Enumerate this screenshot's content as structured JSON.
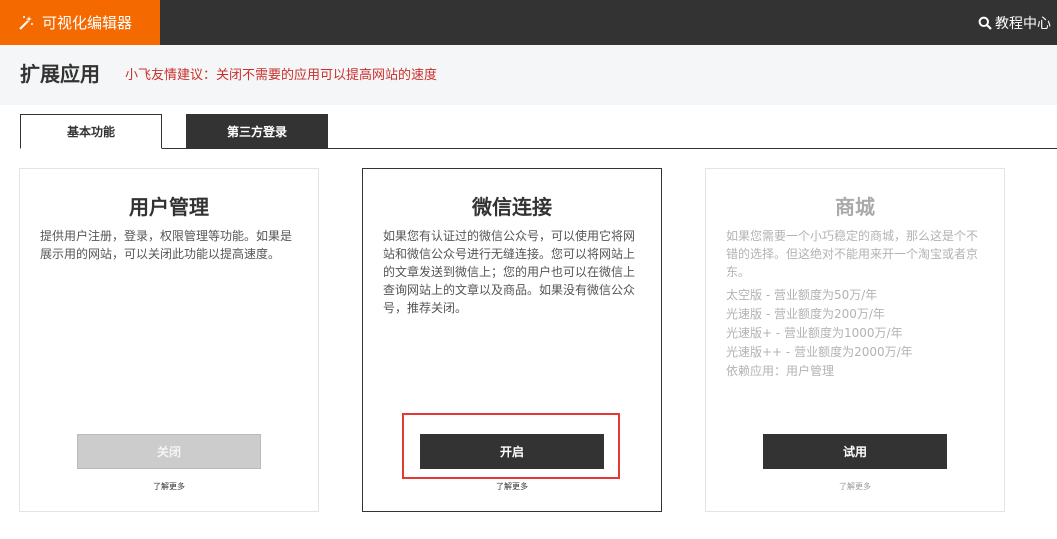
{
  "header": {
    "brand": "可视化编辑器",
    "tutorial": "教程中心"
  },
  "titlebar": {
    "title": "扩展应用",
    "tip": "小飞友情建议：关闭不需要的应用可以提高网站的速度"
  },
  "tabs": [
    {
      "label": "基本功能",
      "active": true
    },
    {
      "label": "第三方登录",
      "active": false
    }
  ],
  "cards": [
    {
      "title": "用户管理",
      "desc": "提供用户注册，登录，权限管理等功能。如果是展示用的网站，可以关闭此功能以提高速度。",
      "button": "关闭",
      "more": "了解更多"
    },
    {
      "title": "微信连接",
      "desc": "如果您有认证过的微信公众号，可以使用它将网站和微信公众号进行无缝连接。您可以将网站上的文章发送到微信上；您的用户也可以在微信上查询网站上的文章以及商品。如果没有微信公众号，推荐关闭。",
      "button": "开启",
      "more": "了解更多"
    },
    {
      "title": "商城",
      "desc": "如果您需要一个小巧稳定的商城，那么这是个不错的选择。但这绝对不能用来开一个淘宝或者京东。",
      "editions": [
        "太空版 - 营业额度为50万/年",
        "光速版 - 营业额度为200万/年",
        "光速版+ - 营业额度为1000万/年",
        "光速版++ - 营业额度为2000万/年"
      ],
      "dependency": "依赖应用：用户管理",
      "button": "试用",
      "more": "了解更多"
    }
  ],
  "colors": {
    "brand": "#f56a00",
    "topbar": "#333333",
    "tip": "#c9302c",
    "highlight": "#e53935"
  }
}
